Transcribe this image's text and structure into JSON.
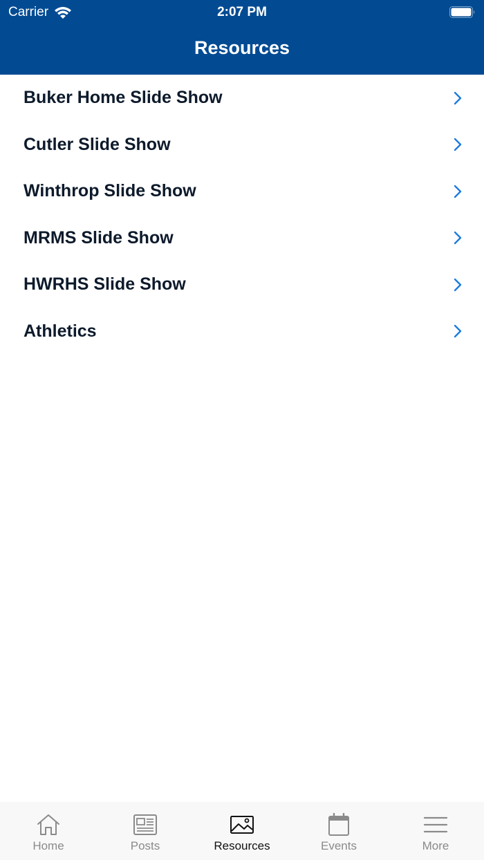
{
  "status_bar": {
    "carrier": "Carrier",
    "time": "2:07 PM"
  },
  "header": {
    "title": "Resources"
  },
  "list": {
    "items": [
      {
        "label": "Buker Home Slide Show"
      },
      {
        "label": "Cutler Slide Show"
      },
      {
        "label": "Winthrop Slide Show"
      },
      {
        "label": "MRMS Slide Show"
      },
      {
        "label": "HWRHS Slide Show"
      },
      {
        "label": "Athletics"
      }
    ]
  },
  "tabbar": {
    "tabs": [
      {
        "label": "Home",
        "icon": "home-icon"
      },
      {
        "label": "Posts",
        "icon": "newspaper-icon"
      },
      {
        "label": "Resources",
        "icon": "image-icon",
        "active": true
      },
      {
        "label": "Events",
        "icon": "calendar-icon"
      },
      {
        "label": "More",
        "icon": "menu-icon"
      }
    ]
  },
  "colors": {
    "header": "#024b93",
    "chevron": "#1c7be0",
    "tab_inactive": "#8a8a8a",
    "tab_active": "#111111"
  }
}
